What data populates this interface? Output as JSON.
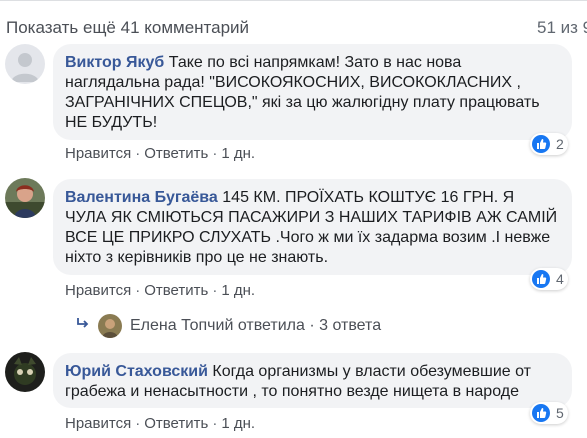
{
  "header": {
    "show_more": "Показать ещё 41 комментарий",
    "count": "51 из 9"
  },
  "comments": [
    {
      "author": "Виктор Якуб",
      "text": " Таке по всі напрямкам! Зато в нас нова наглядальна рада! \"ВИСОКОЯКОСНИХ, ВИСОКОКЛАСНИХ , ЗАГРАНІЧНИХ СПЕЦОВ,\" які за цю жалюгідну плату працювать НЕ БУДУТЬ!",
      "like": "Нравится",
      "reply": "Ответить",
      "time": "1 дн.",
      "reactions": "2"
    },
    {
      "author": "Валентина Бугаёва",
      "text": " 145 КМ. ПРОЇХАТЬ КОШТУЄ 16 ГРН. Я ЧУЛА ЯК СМІЮТЬСЯ ПАСАЖИРИ З НАШИХ ТАРИФІВ АЖ САМІЙ ВСЕ ЦЕ ПРИКРО СЛУХАТЬ .Чого ж ми їх задарма возим .І невже ніхто з керівників про це не знають.",
      "like": "Нравится",
      "reply": "Ответить",
      "time": "1 дн.",
      "reactions": "4",
      "replies": {
        "author": "Елена Топчий",
        "verb": "ответила",
        "sep": "·",
        "count": "3 ответа"
      }
    },
    {
      "author": "Юрий Стаховский",
      "text": " Когда организмы у власти обезумевшие от грабежа и ненасытности , то понятно везде нищета в народе",
      "like": "Нравится",
      "reply": "Ответить",
      "time": "1 дн.",
      "reactions": "5"
    }
  ],
  "colors": {
    "author": "#385898",
    "bubble": "#f2f3f5",
    "like": "#1877f2"
  }
}
